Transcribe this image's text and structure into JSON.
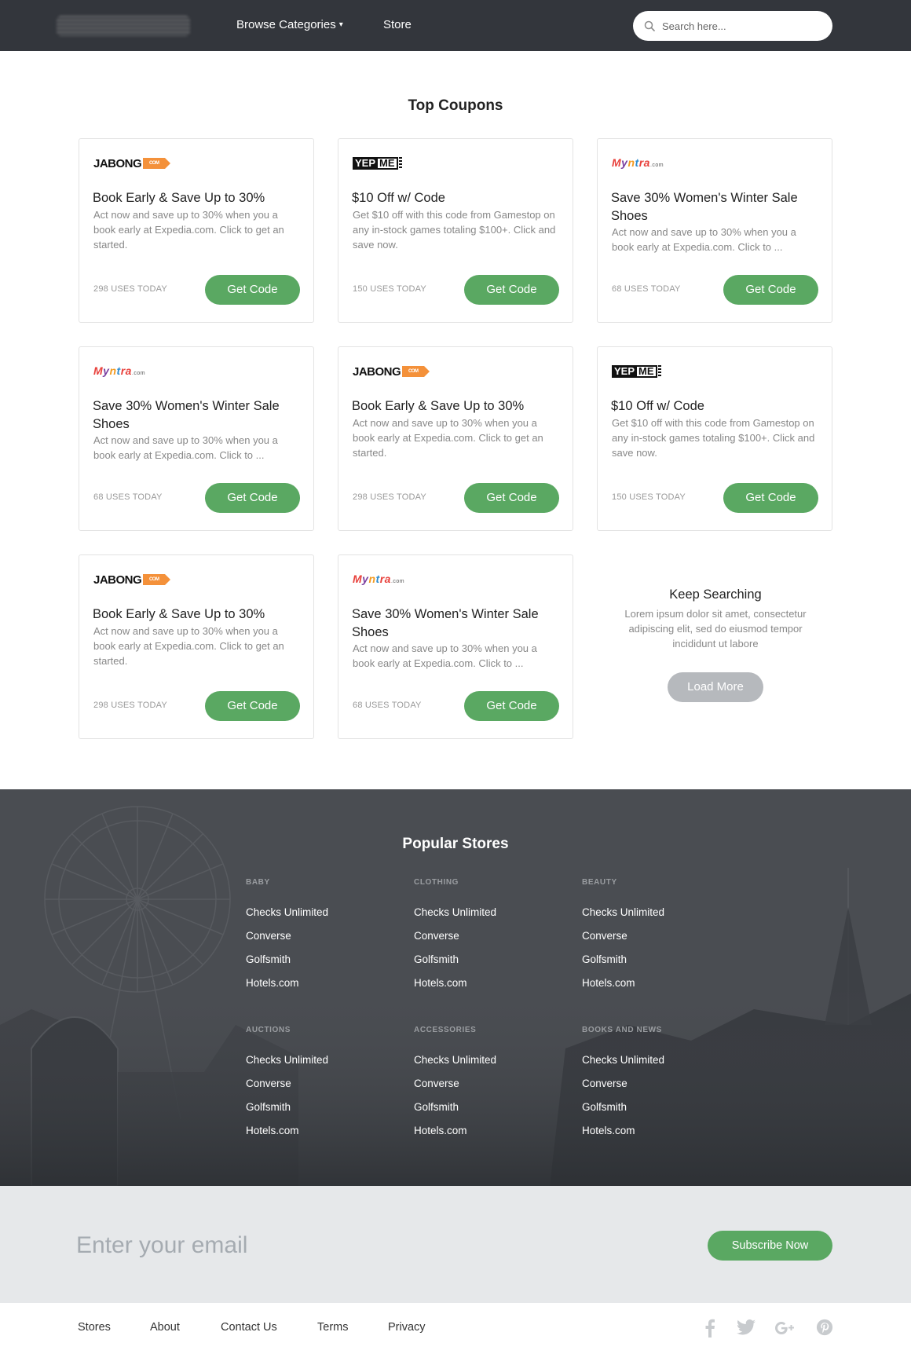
{
  "header": {
    "nav": {
      "browse": "Browse Categories",
      "caret": "▾",
      "store": "Store"
    },
    "search_placeholder": "Search here..."
  },
  "coupons": {
    "title": "Top Coupons",
    "cards": [
      {
        "brand": "jabong",
        "title": "Book Early & Save Up to 30%",
        "desc": "Act now and save up to 30% when you a book early at Expedia.com. Click to get an started.",
        "uses": "298 USES TODAY",
        "button": "Get Code"
      },
      {
        "brand": "yepme",
        "title": "$10 Off w/ Code",
        "desc": "Get $10 off with this code from Gamestop on any in-stock games totaling $100+. Click and save now.",
        "uses": "150 USES TODAY",
        "button": "Get Code"
      },
      {
        "brand": "myntra",
        "title": "Save 30% Women's Winter Sale Shoes",
        "desc": "Act now and save up to 30% when you a book early at Expedia.com. Click to ...",
        "uses": "68 USES TODAY",
        "button": "Get Code"
      },
      {
        "brand": "myntra",
        "title": "Save 30% Women's Winter Sale Shoes",
        "desc": "Act now and save up to 30% when you a book early at Expedia.com. Click to ...",
        "uses": "68 USES TODAY",
        "button": "Get Code"
      },
      {
        "brand": "jabong",
        "title": "Book Early & Save Up to 30%",
        "desc": "Act now and save up to 30% when you a book early at Expedia.com. Click to get an started.",
        "uses": "298 USES TODAY",
        "button": "Get Code"
      },
      {
        "brand": "yepme",
        "title": "$10 Off w/ Code",
        "desc": "Get $10 off with this code from Gamestop on any in-stock games totaling $100+. Click and save now.",
        "uses": "150 USES TODAY",
        "button": "Get Code"
      },
      {
        "brand": "jabong",
        "title": "Book Early & Save Up to 30%",
        "desc": "Act now and save up to 30% when you a book early at Expedia.com. Click to get an started.",
        "uses": "298 USES TODAY",
        "button": "Get Code"
      },
      {
        "brand": "myntra",
        "title": "Save 30% Women's Winter Sale Shoes",
        "desc": "Act now and save up to 30% when you a book early at Expedia.com. Click to ...",
        "uses": "68 USES TODAY",
        "button": "Get Code"
      }
    ],
    "keep_searching": {
      "title": "Keep Searching",
      "text": "Lorem ipsum dolor sit amet, consectetur adipiscing elit, sed do eiusmod tempor incididunt ut labore",
      "button": "Load More"
    }
  },
  "brands": {
    "jabong": {
      "name": "JABONG",
      "tag": "COM"
    },
    "yepme": {
      "left": "YEP",
      "right": "ME"
    },
    "myntra": {
      "letters": [
        "M",
        "y",
        "n",
        "t",
        "r",
        "a"
      ],
      "suffix": ".com"
    }
  },
  "stores": {
    "title": "Popular Stores",
    "columns": [
      {
        "category": "BABY",
        "links": [
          "Checks Unlimited",
          "Converse",
          "Golfsmith",
          "Hotels.com"
        ]
      },
      {
        "category": "CLOTHING",
        "links": [
          "Checks Unlimited",
          "Converse",
          "Golfsmith",
          "Hotels.com"
        ]
      },
      {
        "category": "BEAUTY",
        "links": [
          "Checks Unlimited",
          "Converse",
          "Golfsmith",
          "Hotels.com"
        ]
      },
      {
        "category": "AUCTIONS",
        "links": [
          "Checks Unlimited",
          "Converse",
          "Golfsmith",
          "Hotels.com"
        ]
      },
      {
        "category": "ACCESSORIES",
        "links": [
          "Checks Unlimited",
          "Converse",
          "Golfsmith",
          "Hotels.com"
        ]
      },
      {
        "category": "BOOKS AND NEWS",
        "links": [
          "Checks Unlimited",
          "Converse",
          "Golfsmith",
          "Hotels.com"
        ]
      }
    ]
  },
  "subscribe": {
    "placeholder": "Enter your email",
    "button": "Subscribe Now"
  },
  "footer": {
    "links": [
      "Stores",
      "About",
      "Contact Us",
      "Terms",
      "Privacy"
    ],
    "social": [
      "facebook-icon",
      "twitter-icon",
      "google-plus-icon",
      "pinterest-icon"
    ]
  },
  "colors": {
    "header_bg": "#33363c",
    "accent_green": "#5aa862",
    "stores_bg": "#4a4d52",
    "subscribe_bg": "#e6e8ea"
  }
}
